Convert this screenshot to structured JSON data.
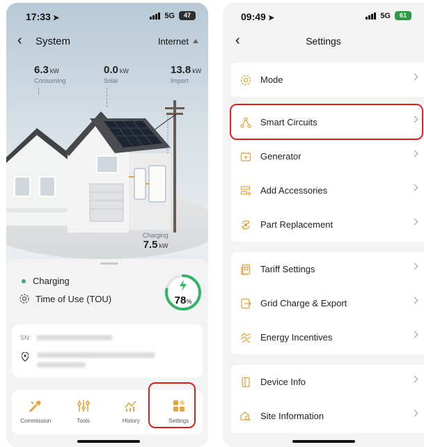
{
  "left": {
    "status": {
      "time": "17:33",
      "network": "5G",
      "battery": "47"
    },
    "nav": {
      "back": "‹",
      "title": "System",
      "network_mode": "Internet"
    },
    "stats": {
      "consuming": {
        "value": "6.3",
        "unit": "kW",
        "label": "Consuming"
      },
      "solar": {
        "value": "0.0",
        "unit": "kW",
        "label": "Solar"
      },
      "import": {
        "value": "13.8",
        "unit": "kW",
        "label": "Import"
      },
      "charging": {
        "value": "7.5",
        "unit": "kW",
        "label": "Charging"
      }
    },
    "sheet": {
      "state": "Charging",
      "mode": "Time of Use (TOU)",
      "battery_percent": "78",
      "percent_sign": "%",
      "battery_fraction": 0.78,
      "sn_label": "SN:"
    },
    "toolbar": [
      {
        "label": "Commission",
        "icon": "wrench-icon"
      },
      {
        "label": "Tools",
        "icon": "sliders-icon"
      },
      {
        "label": "History",
        "icon": "history-chart-icon"
      },
      {
        "label": "Settings",
        "icon": "settings-grid-icon"
      }
    ]
  },
  "right": {
    "status": {
      "time": "09:49",
      "network": "5G",
      "battery": "61"
    },
    "nav": {
      "back": "‹",
      "title": "Settings"
    },
    "groups": [
      [
        {
          "label": "Mode",
          "icon": "mode-icon"
        }
      ],
      [
        {
          "label": "Smart Circuits",
          "icon": "smart-circuits-icon"
        },
        {
          "label": "Generator",
          "icon": "generator-icon"
        },
        {
          "label": "Add Accessories",
          "icon": "add-accessories-icon"
        },
        {
          "label": "Part Replacement",
          "icon": "part-replacement-icon"
        }
      ],
      [
        {
          "label": "Tariff Settings",
          "icon": "tariff-icon"
        },
        {
          "label": "Grid Charge & Export",
          "icon": "grid-export-icon"
        },
        {
          "label": "Energy Incentives",
          "icon": "energy-incentives-icon"
        }
      ],
      [
        {
          "label": "Device Info",
          "icon": "device-info-icon"
        },
        {
          "label": "Site Information",
          "icon": "site-info-icon"
        }
      ]
    ]
  },
  "colors": {
    "accent": "#e8a23c",
    "highlight": "#e11d1d",
    "green": "#35b36b"
  }
}
